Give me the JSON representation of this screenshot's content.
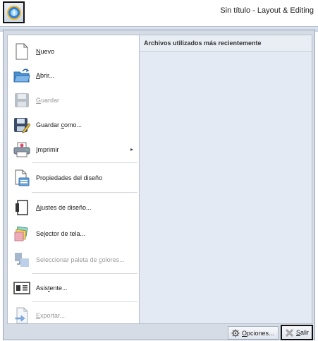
{
  "window": {
    "title": "Sin título - Layout & Editing"
  },
  "recent_files": {
    "header": "Archivos utilizados más recientemente"
  },
  "menu": {
    "items": [
      {
        "label": "Nuevo",
        "icon": "new-document-icon",
        "enabled": true
      },
      {
        "label": "Abrir...",
        "icon": "open-folder-icon",
        "enabled": true
      },
      {
        "label": "Guardar",
        "icon": "save-icon",
        "enabled": false
      },
      {
        "label": "Guardar como...",
        "icon": "save-as-icon",
        "enabled": true
      },
      {
        "label": "Imprimir",
        "icon": "print-icon",
        "enabled": true,
        "submenu": true
      },
      {
        "label": "Propiedades del diseño",
        "icon": "design-properties-icon",
        "enabled": true
      },
      {
        "label": "Ajustes de diseño...",
        "icon": "design-settings-icon",
        "enabled": true
      },
      {
        "label": "Selector de tela...",
        "icon": "fabric-selector-icon",
        "enabled": true
      },
      {
        "label": "Seleccionar paleta de colores...",
        "icon": "color-palette-icon",
        "enabled": false
      },
      {
        "label": "Asistente...",
        "icon": "wizard-icon",
        "enabled": true
      },
      {
        "label": "Exportar...",
        "icon": "export-icon",
        "enabled": false
      }
    ]
  },
  "buttons": {
    "options": "Opciones...",
    "exit": "Salir"
  },
  "colors": {
    "frame": "#d6dce6",
    "recent_panel": "#e3eaf3",
    "disabled_text": "#9a9a9a"
  }
}
